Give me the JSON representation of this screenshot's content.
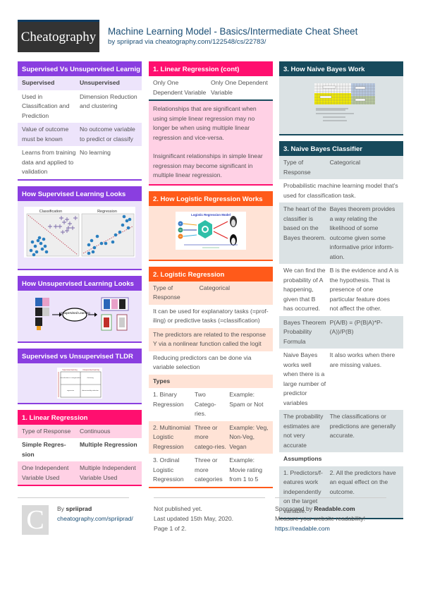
{
  "header": {
    "logo": "Cheatography",
    "title": "Machine Learning Model - Basics/Intermediate Cheat Sheet",
    "by_prefix": "by ",
    "author": "spriiprad",
    "via": " via ",
    "url": "cheatography.com/122548/cs/22783/"
  },
  "colors": {
    "purple": "#8a3ee0",
    "pink": "#ff0f6f",
    "orange": "#ff5a1a",
    "teal": "#174a5c",
    "link": "#1a4d74"
  },
  "sections": {
    "sup_vs_unsup": {
      "title": "Supervised Vs Unsupervised Learnig",
      "head": [
        "Supervised",
        "Unsupervised"
      ],
      "rows": [
        [
          "Used in Classification and Prediction",
          "Dimension Reduction and clustering"
        ],
        [
          "Value of outcome must be known",
          "No outcome variable to predict or classify"
        ],
        [
          "Learns from training data and applied to validation",
          "No learning"
        ]
      ]
    },
    "how_sup": {
      "title": "How Supervised Learning Looks",
      "image": {
        "left_label": "Classification",
        "right_label": "Regression"
      }
    },
    "how_unsup": {
      "title": "How Unsupervised Learning Looks",
      "image": {
        "center_label": "Unsupervised Learning"
      }
    },
    "tldr": {
      "title": "Supervised vs Unsupervised TLDR",
      "image": {
        "cols": [
          "Supervised learning",
          "Unsupervised learning"
        ],
        "cells": [
          "classification or categorization",
          "clustering",
          "regression",
          "dimensionality reduction"
        ]
      }
    },
    "linreg": {
      "title": "1. Linear Regression",
      "rows": [
        [
          "Type of Response",
          "Continuous"
        ],
        [
          "Simple Regres-sion",
          "Multiple Regression"
        ],
        [
          "One Independent Variable Used",
          "Multiple Independent Variable Used"
        ]
      ]
    },
    "linreg_cont": {
      "title": "1. Linear Regression (cont)",
      "row": [
        "Only One Dependent Variable",
        "Only One Dependent Variable"
      ],
      "para1": "Relationships that are significant when using simple linear regression may no longer be when using multiple linear regression and vice-versa.",
      "para2": "Insignificant relationships in simple linear regression may become significant in multiple linear regression."
    },
    "how_logreg": {
      "title": "2. How Logistic Regression Works",
      "image": {
        "title": "Logistic Regression Model",
        "inputs": [
          "X1",
          "X2",
          "X3"
        ]
      }
    },
    "logreg": {
      "title": "2. Logistic Regression",
      "type_row": [
        "Type of Response",
        "Categorical"
      ],
      "full_rows": [
        "It can be used for explanatory tasks (=prof-iling) or predictive tasks (=classification)",
        "The predictors are related to the response Y via a nonlinear function called the logit",
        "Reducing predictors can be done via variable selection"
      ],
      "types_label": "Types",
      "types": [
        [
          "1. Binary Regression",
          "Two Catego-ries.",
          "Example: Spam or Not"
        ],
        [
          "2. Multinomial Logistic Regression",
          "Three or more catego-ries.",
          "Example: Veg, Non-Veg, Vegan"
        ],
        [
          "3. Ordinal Logistic Regression",
          "Three or more categories",
          "Example: Movie rating from 1 to 5"
        ]
      ]
    },
    "how_nb": {
      "title": "3. How Naive Bayes Work"
    },
    "nb": {
      "title": "3. Naive Bayes Classifier",
      "type_row": [
        "Type of Response",
        "Categorical"
      ],
      "full_row": "Probabilistic machine learning model that's used for classification task.",
      "rows": [
        [
          "The heart of the classifier is based on the Bayes theorem.",
          "Bayes theorem provides a way relating the likelihood of some outcome given some informative prior inform-ation."
        ],
        [
          "We can find the probability of A happening, given that B has occurred.",
          "B is the evidence and A is the hypothesis. That is presence of one particular feature does not affect the other."
        ],
        [
          "Bayes Theorem Probability Formula",
          "P(A/B) = (P(B|A)*P-(A))/P(B)"
        ],
        [
          "Naive Bayes works well when there is a large number of predictor variables",
          "It also works when there are missing values."
        ],
        [
          "The probability estimates are not very accurate",
          "The classifications or predictions are generally accurate."
        ]
      ],
      "assumptions_label": "Assumptions",
      "assumptions": [
        "1. Predictors/f-eatures work independently on the target variable.",
        "2. All the predictors have an equal effect on the outcome."
      ]
    }
  },
  "footer": {
    "avatar_letter": "C",
    "by_label": "By ",
    "author": "spriiprad",
    "author_url": "cheatography.com/spriiprad/",
    "status": "Not published yet.",
    "updated": "Last updated 15th May, 2020.",
    "page": "Page 1 of 2.",
    "sponsored_prefix": "Sponsored by ",
    "sponsor": "Readable.com",
    "sponsor_tagline": "Measure your website readability!",
    "sponsor_url": "https://readable.com"
  }
}
